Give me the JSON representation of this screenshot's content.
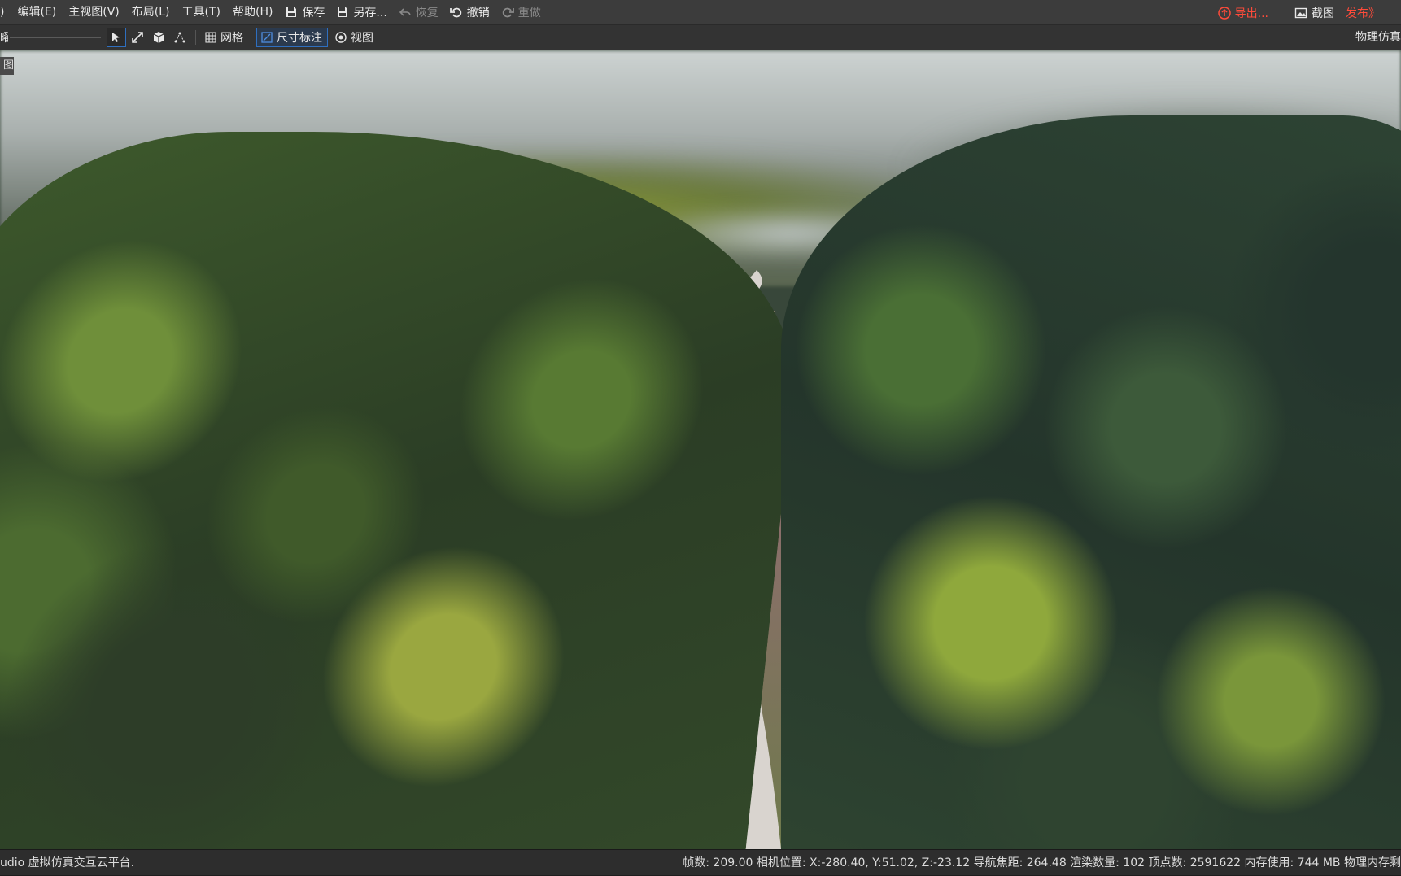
{
  "menubar": {
    "items": [
      {
        "label": ")"
      },
      {
        "label": "编辑(E)"
      },
      {
        "label": "主视图(V)"
      },
      {
        "label": "布局(L)"
      },
      {
        "label": "工具(T)"
      },
      {
        "label": "帮助(H)"
      }
    ],
    "save_label": "保存",
    "save_as_label": "另存...",
    "restore_label": "恢复",
    "undo_label": "撤销",
    "redo_label": "重做",
    "export_label": "导出...",
    "screenshot_label": "截图",
    "publish_label": "发布》"
  },
  "toolbar": {
    "left_stub": "曜",
    "grid_label": "网格",
    "dimension_label": "尺寸标注",
    "view_label": "视图",
    "right_label": "物理仿真"
  },
  "viewport": {
    "tab_label": "图"
  },
  "statusbar": {
    "left_text": "udio 虚拟仿真交互云平台.",
    "fps": "帧数: 209.00",
    "camera_position": "相机位置: X:-280.40, Y:51.02, Z:-23.12",
    "nav_focus": "导航焦距: 264.48",
    "render_count": "渲染数量: 102",
    "vertex_count": "顶点数: 2591622",
    "memory_used": "内存使用: 744 MB",
    "physical_memory": "物理内存剩"
  },
  "colors": {
    "accent_blue": "#2f6fbf",
    "export_red": "#ff4b3a"
  }
}
